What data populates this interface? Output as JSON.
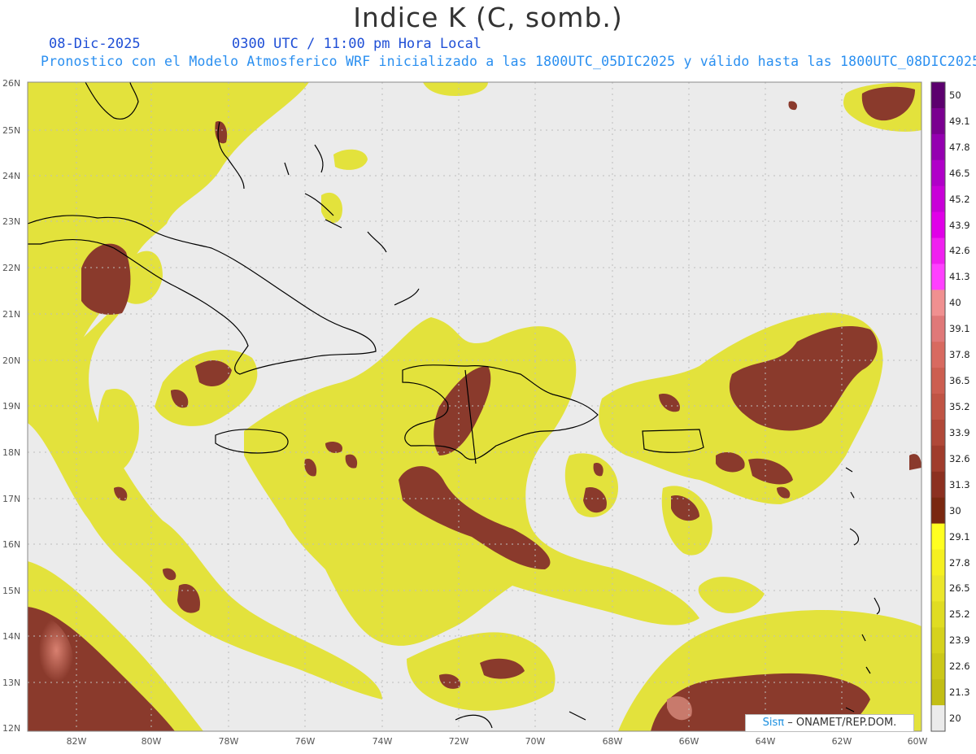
{
  "title": "Indice K (C, somb.)",
  "date": "08-Dic-2025",
  "time": "0300 UTC / 11:00 pm Hora Local",
  "subtitle": "Pronostico con el Modelo Atmosferico WRF inicializado a las 1800UTC_05DIC2025 y válido hasta las  1800UTC_08DIC2025",
  "lat_labels": [
    "26N",
    "25N",
    "24N",
    "23N",
    "22N",
    "21N",
    "20N",
    "19N",
    "18N",
    "17N",
    "16N",
    "15N",
    "14N",
    "13N",
    "12N"
  ],
  "lon_labels": [
    "82W",
    "80W",
    "78W",
    "76W",
    "74W",
    "72W",
    "70W",
    "68W",
    "66W",
    "64W",
    "62W",
    "60W"
  ],
  "colorbar": {
    "labels": [
      "50",
      "49.1",
      "47.8",
      "46.5",
      "45.2",
      "43.9",
      "42.6",
      "41.3",
      "40",
      "39.1",
      "37.8",
      "36.5",
      "35.2",
      "33.9",
      "32.6",
      "31.3",
      "30",
      "29.1",
      "27.8",
      "26.5",
      "25.2",
      "23.9",
      "22.6",
      "21.3",
      "20"
    ],
    "colors": [
      "#5c006e",
      "#7a0090",
      "#9400b0",
      "#b000c8",
      "#c800d8",
      "#e000e8",
      "#f020f0",
      "#ff40ff",
      "#f09090",
      "#e07878",
      "#d86a60",
      "#cc5e50",
      "#c05444",
      "#b04838",
      "#a03c2c",
      "#8c3020",
      "#7a2810",
      "#ffff20",
      "#f5f020",
      "#ebe62a",
      "#e0dc22",
      "#d6d21c",
      "#ccc818",
      "#c2be14",
      "#ebebeb"
    ]
  },
  "credit": {
    "brand": "Sisπ",
    "text": "– ONAMET/REP.DOM."
  },
  "colors": {
    "background": "#ebebeb",
    "yellow": "#e8e84a",
    "brown": "#8a3a2c",
    "coast": "#000000"
  }
}
